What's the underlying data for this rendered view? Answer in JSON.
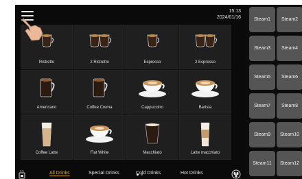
{
  "header": {
    "time": "15:13",
    "date": "2024/01/16"
  },
  "drinks": [
    {
      "label": "Ristretto",
      "icon": "espresso-cup-icon"
    },
    {
      "label": "2 Ristretto",
      "icon": "double-espresso-cup-icon"
    },
    {
      "label": "Espresso",
      "icon": "espresso-cup-icon"
    },
    {
      "label": "2 Espresso",
      "icon": "double-espresso-cup-icon"
    },
    {
      "label": "Americano",
      "icon": "mug-icon"
    },
    {
      "label": "Coffee Crema",
      "icon": "mug-icon"
    },
    {
      "label": "Cappuccino",
      "icon": "cappuccino-cup-icon"
    },
    {
      "label": "Barista",
      "icon": "cappuccino-cup-icon"
    },
    {
      "label": "Coffee Latte",
      "icon": "latte-glass-icon"
    },
    {
      "label": "Flat White",
      "icon": "cappuccino-cup-icon"
    },
    {
      "label": "Macchiato",
      "icon": "macchiato-glass-icon"
    },
    {
      "label": "Latte macchiato",
      "icon": "latte-macchiato-glass-icon"
    }
  ],
  "categories": [
    {
      "label": "All Drinks",
      "active": true
    },
    {
      "label": "Special Drinks",
      "active": false
    },
    {
      "label": "Cold Drinks",
      "active": false
    },
    {
      "label": "Hot Drinks",
      "active": false
    }
  ],
  "pager": {
    "pages": 2,
    "current": 1
  },
  "steam": [
    "Steam1",
    "Steam2",
    "Steam3",
    "Steam4",
    "Steam5",
    "Steam6",
    "Steam7",
    "Steam8",
    "Steam9",
    "Steam10",
    "Steam11",
    "Steam12"
  ],
  "colors": {
    "accent": "#e3b01a",
    "tile": "#1f1f1f",
    "steam_button": "#555555"
  }
}
